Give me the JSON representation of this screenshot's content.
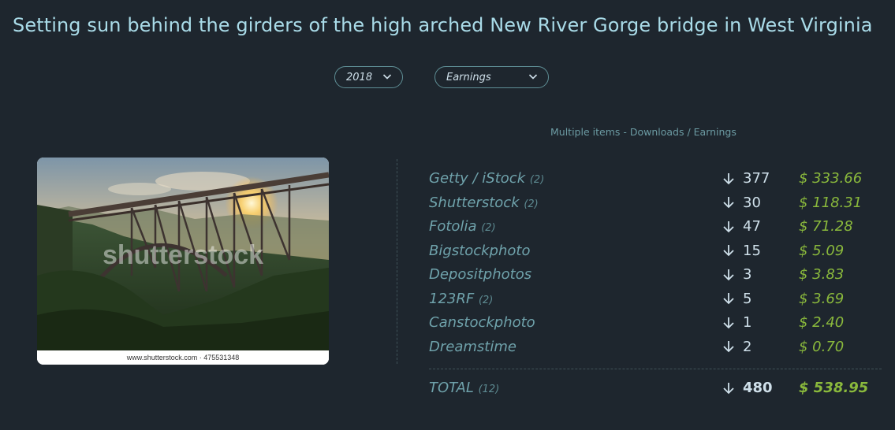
{
  "title": "Setting sun behind the girders of the high arched New River Gorge bridge in West Virginia",
  "filters": {
    "year": "2018",
    "metric": "Earnings"
  },
  "subheading": "Multiple items - Downloads / Earnings",
  "image": {
    "watermark": "shutterstock",
    "caption": "www.shutterstock.com · 475531348"
  },
  "agencies": [
    {
      "name": "Getty / iStock",
      "count": "(2)",
      "downloads": "377",
      "earnings": "$ 333.66"
    },
    {
      "name": "Shutterstock",
      "count": "(2)",
      "downloads": "30",
      "earnings": "$ 118.31"
    },
    {
      "name": "Fotolia",
      "count": "(2)",
      "downloads": "47",
      "earnings": "$ 71.28"
    },
    {
      "name": "Bigstockphoto",
      "count": "",
      "downloads": "15",
      "earnings": "$ 5.09"
    },
    {
      "name": "Depositphotos",
      "count": "",
      "downloads": "3",
      "earnings": "$ 3.83"
    },
    {
      "name": "123RF",
      "count": "(2)",
      "downloads": "5",
      "earnings": "$ 3.69"
    },
    {
      "name": "Canstockphoto",
      "count": "",
      "downloads": "1",
      "earnings": "$ 2.40"
    },
    {
      "name": "Dreamstime",
      "count": "",
      "downloads": "2",
      "earnings": "$ 0.70"
    }
  ],
  "total": {
    "name": "TOTAL",
    "count": "(12)",
    "downloads": "480",
    "earnings": "$ 538.95"
  },
  "colors": {
    "background": "#1e262e",
    "title": "#a9dbe8",
    "agency": "#6fa2ab",
    "earnings": "#8ab93c"
  },
  "icons": {
    "dropdown": "chevron-down-icon",
    "downloads": "arrow-down-icon"
  }
}
